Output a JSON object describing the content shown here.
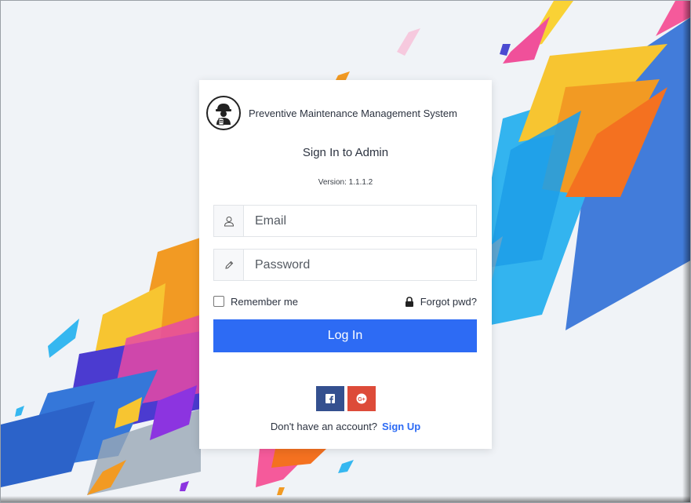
{
  "brand": {
    "title": "Preventive Maintenance Management System",
    "logo_icon": "worker-with-hardhat-icon"
  },
  "signin": {
    "title": "Sign In to Admin",
    "version": "Version: 1.1.1.2"
  },
  "form": {
    "email": {
      "value": "",
      "placeholder": "Email",
      "icon": "user-icon"
    },
    "password": {
      "value": "",
      "placeholder": "Password",
      "icon": "pencil-icon"
    },
    "remember_label": "Remember me",
    "remember_checked": false,
    "forgot_label": "Forgot pwd?",
    "forgot_icon": "lock-icon",
    "login_label": "Log In"
  },
  "social": {
    "facebook_icon": "facebook-icon",
    "google_icon": "google-plus-icon"
  },
  "signup": {
    "prompt": "Don't have an account?",
    "link": "Sign Up"
  },
  "colors": {
    "primary": "#2d6bf4",
    "facebook": "#34508f",
    "google": "#dd4b39",
    "background": "#f0f3f7"
  }
}
